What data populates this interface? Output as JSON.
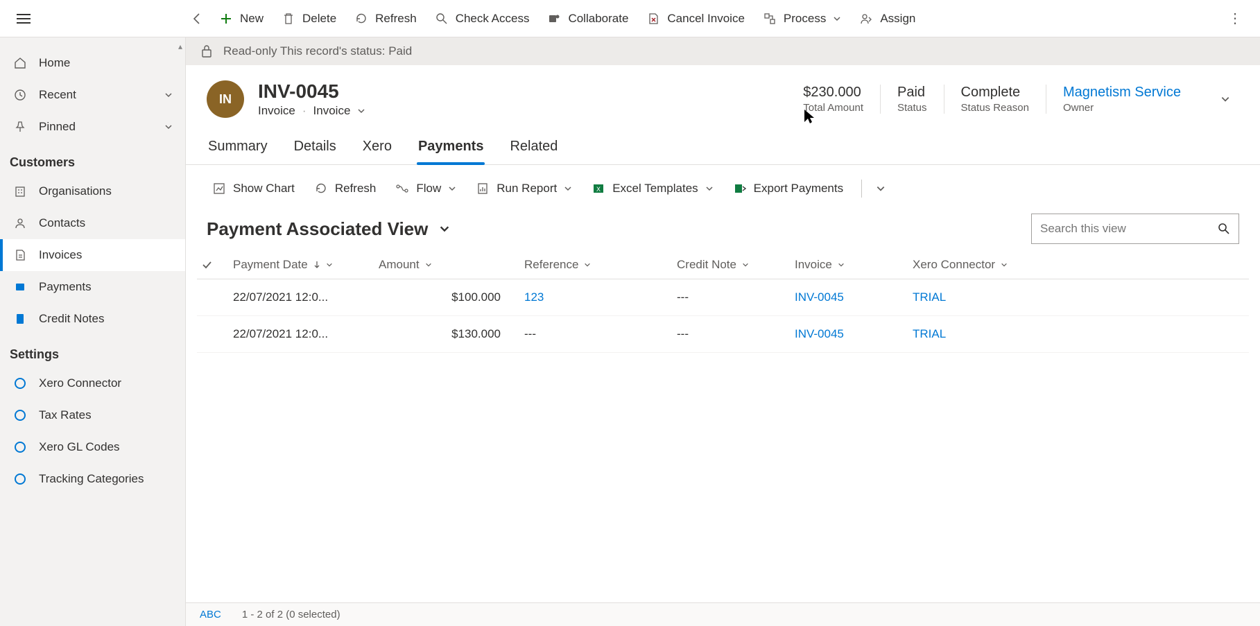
{
  "cmdbar": {
    "new": "New",
    "delete": "Delete",
    "refresh": "Refresh",
    "check_access": "Check Access",
    "collaborate": "Collaborate",
    "cancel_invoice": "Cancel Invoice",
    "process": "Process",
    "assign": "Assign"
  },
  "sidebar": {
    "home": "Home",
    "recent": "Recent",
    "pinned": "Pinned",
    "group_customers": "Customers",
    "organisations": "Organisations",
    "contacts": "Contacts",
    "invoices": "Invoices",
    "payments": "Payments",
    "credit_notes": "Credit Notes",
    "group_settings": "Settings",
    "xero_connector": "Xero Connector",
    "tax_rates": "Tax Rates",
    "xero_gl_codes": "Xero GL Codes",
    "tracking_categories": "Tracking Categories"
  },
  "notice": {
    "text": "Read-only This record's status: Paid"
  },
  "record": {
    "avatar": "IN",
    "title": "INV-0045",
    "entity": "Invoice",
    "form": "Invoice",
    "total_amount": "$230.000",
    "total_amount_label": "Total Amount",
    "status": "Paid",
    "status_label": "Status",
    "status_reason": "Complete",
    "status_reason_label": "Status Reason",
    "owner": "Magnetism Service",
    "owner_label": "Owner"
  },
  "tabs": {
    "summary": "Summary",
    "details": "Details",
    "xero": "Xero",
    "payments": "Payments",
    "related": "Related"
  },
  "subcmd": {
    "show_chart": "Show Chart",
    "refresh": "Refresh",
    "flow": "Flow",
    "run_report": "Run Report",
    "excel_templates": "Excel Templates",
    "export_payments": "Export Payments"
  },
  "view": {
    "title": "Payment Associated View",
    "search_placeholder": "Search this view"
  },
  "columns": {
    "payment_date": "Payment Date",
    "amount": "Amount",
    "reference": "Reference",
    "credit_note": "Credit Note",
    "invoice": "Invoice",
    "xero_connector": "Xero Connector"
  },
  "rows": [
    {
      "date": "22/07/2021 12:0...",
      "amount": "$100.000",
      "reference": "123",
      "credit_note": "---",
      "invoice": "INV-0045",
      "connector": "TRIAL"
    },
    {
      "date": "22/07/2021 12:0...",
      "amount": "$130.000",
      "reference": "---",
      "credit_note": "---",
      "invoice": "INV-0045",
      "connector": "TRIAL"
    }
  ],
  "footer": {
    "abc": "ABC",
    "count": "1 - 2 of 2 (0 selected)"
  }
}
